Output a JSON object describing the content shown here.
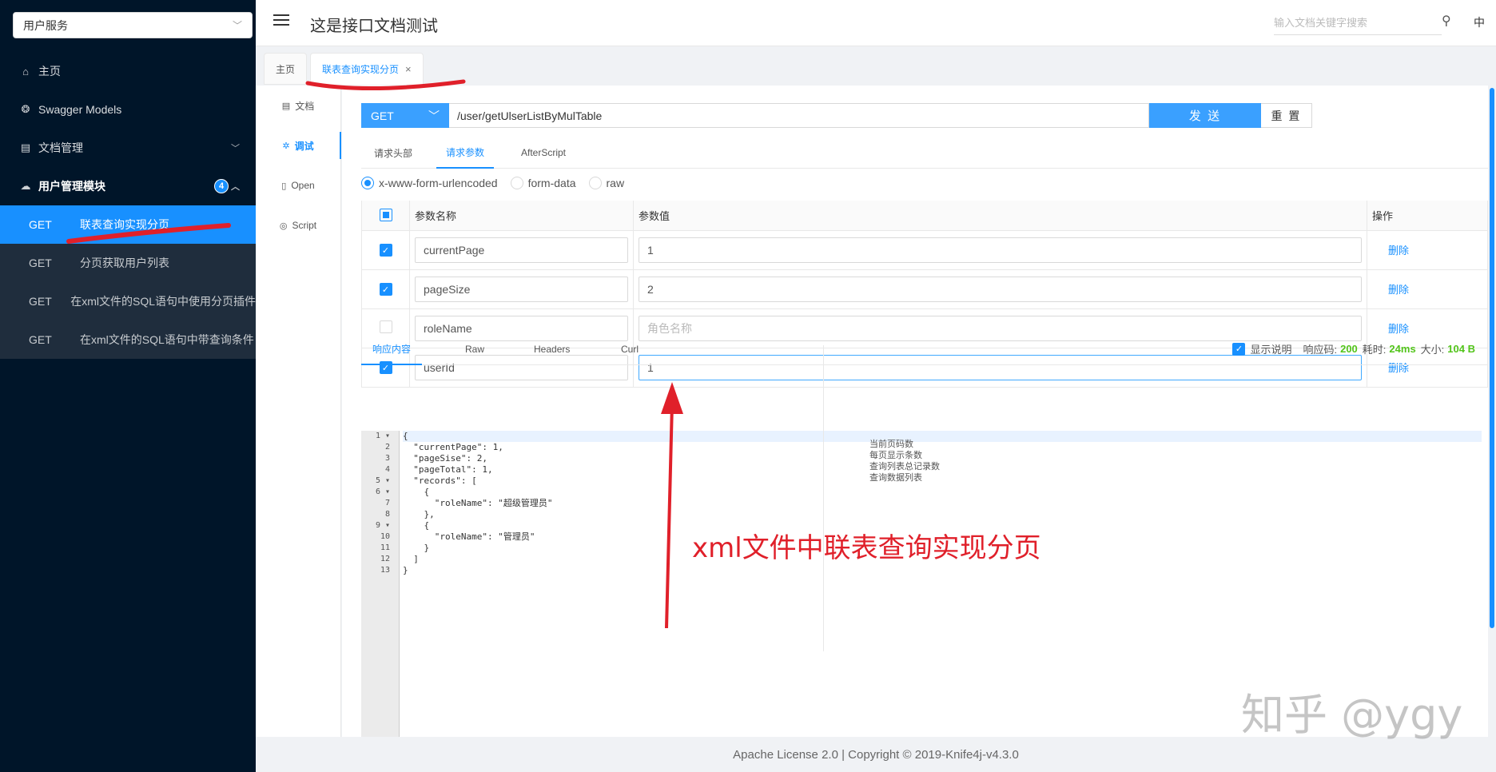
{
  "sidebar": {
    "service_select": "用户服务",
    "items": [
      {
        "label": "主页",
        "icon": "home-icon"
      },
      {
        "label": "Swagger Models",
        "icon": "cube-icon"
      },
      {
        "label": "文档管理",
        "icon": "doc-icon"
      },
      {
        "label": "用户管理模块",
        "icon": "cloud-icon",
        "badge": "4"
      }
    ],
    "endpoints": [
      {
        "method": "GET",
        "label": "联表查询实现分页"
      },
      {
        "method": "GET",
        "label": "分页获取用户列表"
      },
      {
        "method": "GET",
        "label": "在xml文件的SQL语句中使用分页插件"
      },
      {
        "method": "GET",
        "label": "在xml文件的SQL语句中带查询条件"
      }
    ]
  },
  "header": {
    "title": "这是接口文档测试",
    "search_placeholder": "输入文档关键字搜索",
    "lang": "中"
  },
  "tabs": [
    {
      "label": "主页"
    },
    {
      "label": "联表查询实现分页",
      "close": "×"
    }
  ],
  "subnav": [
    {
      "label": "文档",
      "icon": "▤"
    },
    {
      "label": "调试",
      "icon": "✲"
    },
    {
      "label": "Open",
      "icon": "▯"
    },
    {
      "label": "Script",
      "icon": "◎"
    }
  ],
  "request": {
    "method": "GET",
    "url": "/user/getUlserListByMulTable",
    "send": "发 送",
    "reset": "重 置",
    "tabs": [
      "请求头部",
      "请求参数",
      "AfterScript"
    ],
    "content_types": [
      "x-www-form-urlencoded",
      "form-data",
      "raw"
    ],
    "columns": [
      "参数名称",
      "参数值",
      "操作"
    ],
    "params": [
      {
        "name": "currentPage",
        "value": "1",
        "placeholder": "",
        "checked": true,
        "action": "删除"
      },
      {
        "name": "pageSize",
        "value": "2",
        "placeholder": "",
        "checked": true,
        "action": "删除"
      },
      {
        "name": "roleName",
        "value": "",
        "placeholder": "角色名称",
        "checked": false,
        "action": "删除"
      },
      {
        "name": "userId",
        "value": "1",
        "placeholder": "",
        "checked": true,
        "action": "删除"
      }
    ]
  },
  "response": {
    "tabs": [
      "响应内容",
      "Raw",
      "Headers",
      "Curl"
    ],
    "show_desc": "显示说明",
    "code_label": "响应码:",
    "code": "200",
    "time_label": "耗时:",
    "time": "24ms",
    "size_label": "大小:",
    "size": "104 B",
    "lines": [
      "{",
      "  \"currentPage\": 1,",
      "  \"pageSise\": 2,",
      "  \"pageTotal\": 1,",
      "  \"records\": [",
      "    {",
      "      \"roleName\": \"超级管理员\"",
      "    },",
      "    {",
      "      \"roleName\": \"管理员\"",
      "    }",
      "  ]",
      "}"
    ],
    "line_numbers": [
      "1 ▾",
      "2",
      "3",
      "4",
      "5 ▾",
      "6 ▾",
      "7",
      "8",
      "9 ▾",
      "10",
      "11",
      "12",
      "13"
    ],
    "annotations": [
      "当前页码数",
      "每页显示条数",
      "查询列表总记录数",
      "查询数据列表"
    ]
  },
  "annotation_text": "xml文件中联表查询实现分页",
  "footer": "Apache License 2.0 | Copyright © 2019-Knife4j-v4.3.0",
  "watermark": "知乎 @ygy",
  "colors": {
    "primary": "#1890ff",
    "sidebar": "#001529",
    "annotation": "#e0202a",
    "success": "#52c41a"
  }
}
